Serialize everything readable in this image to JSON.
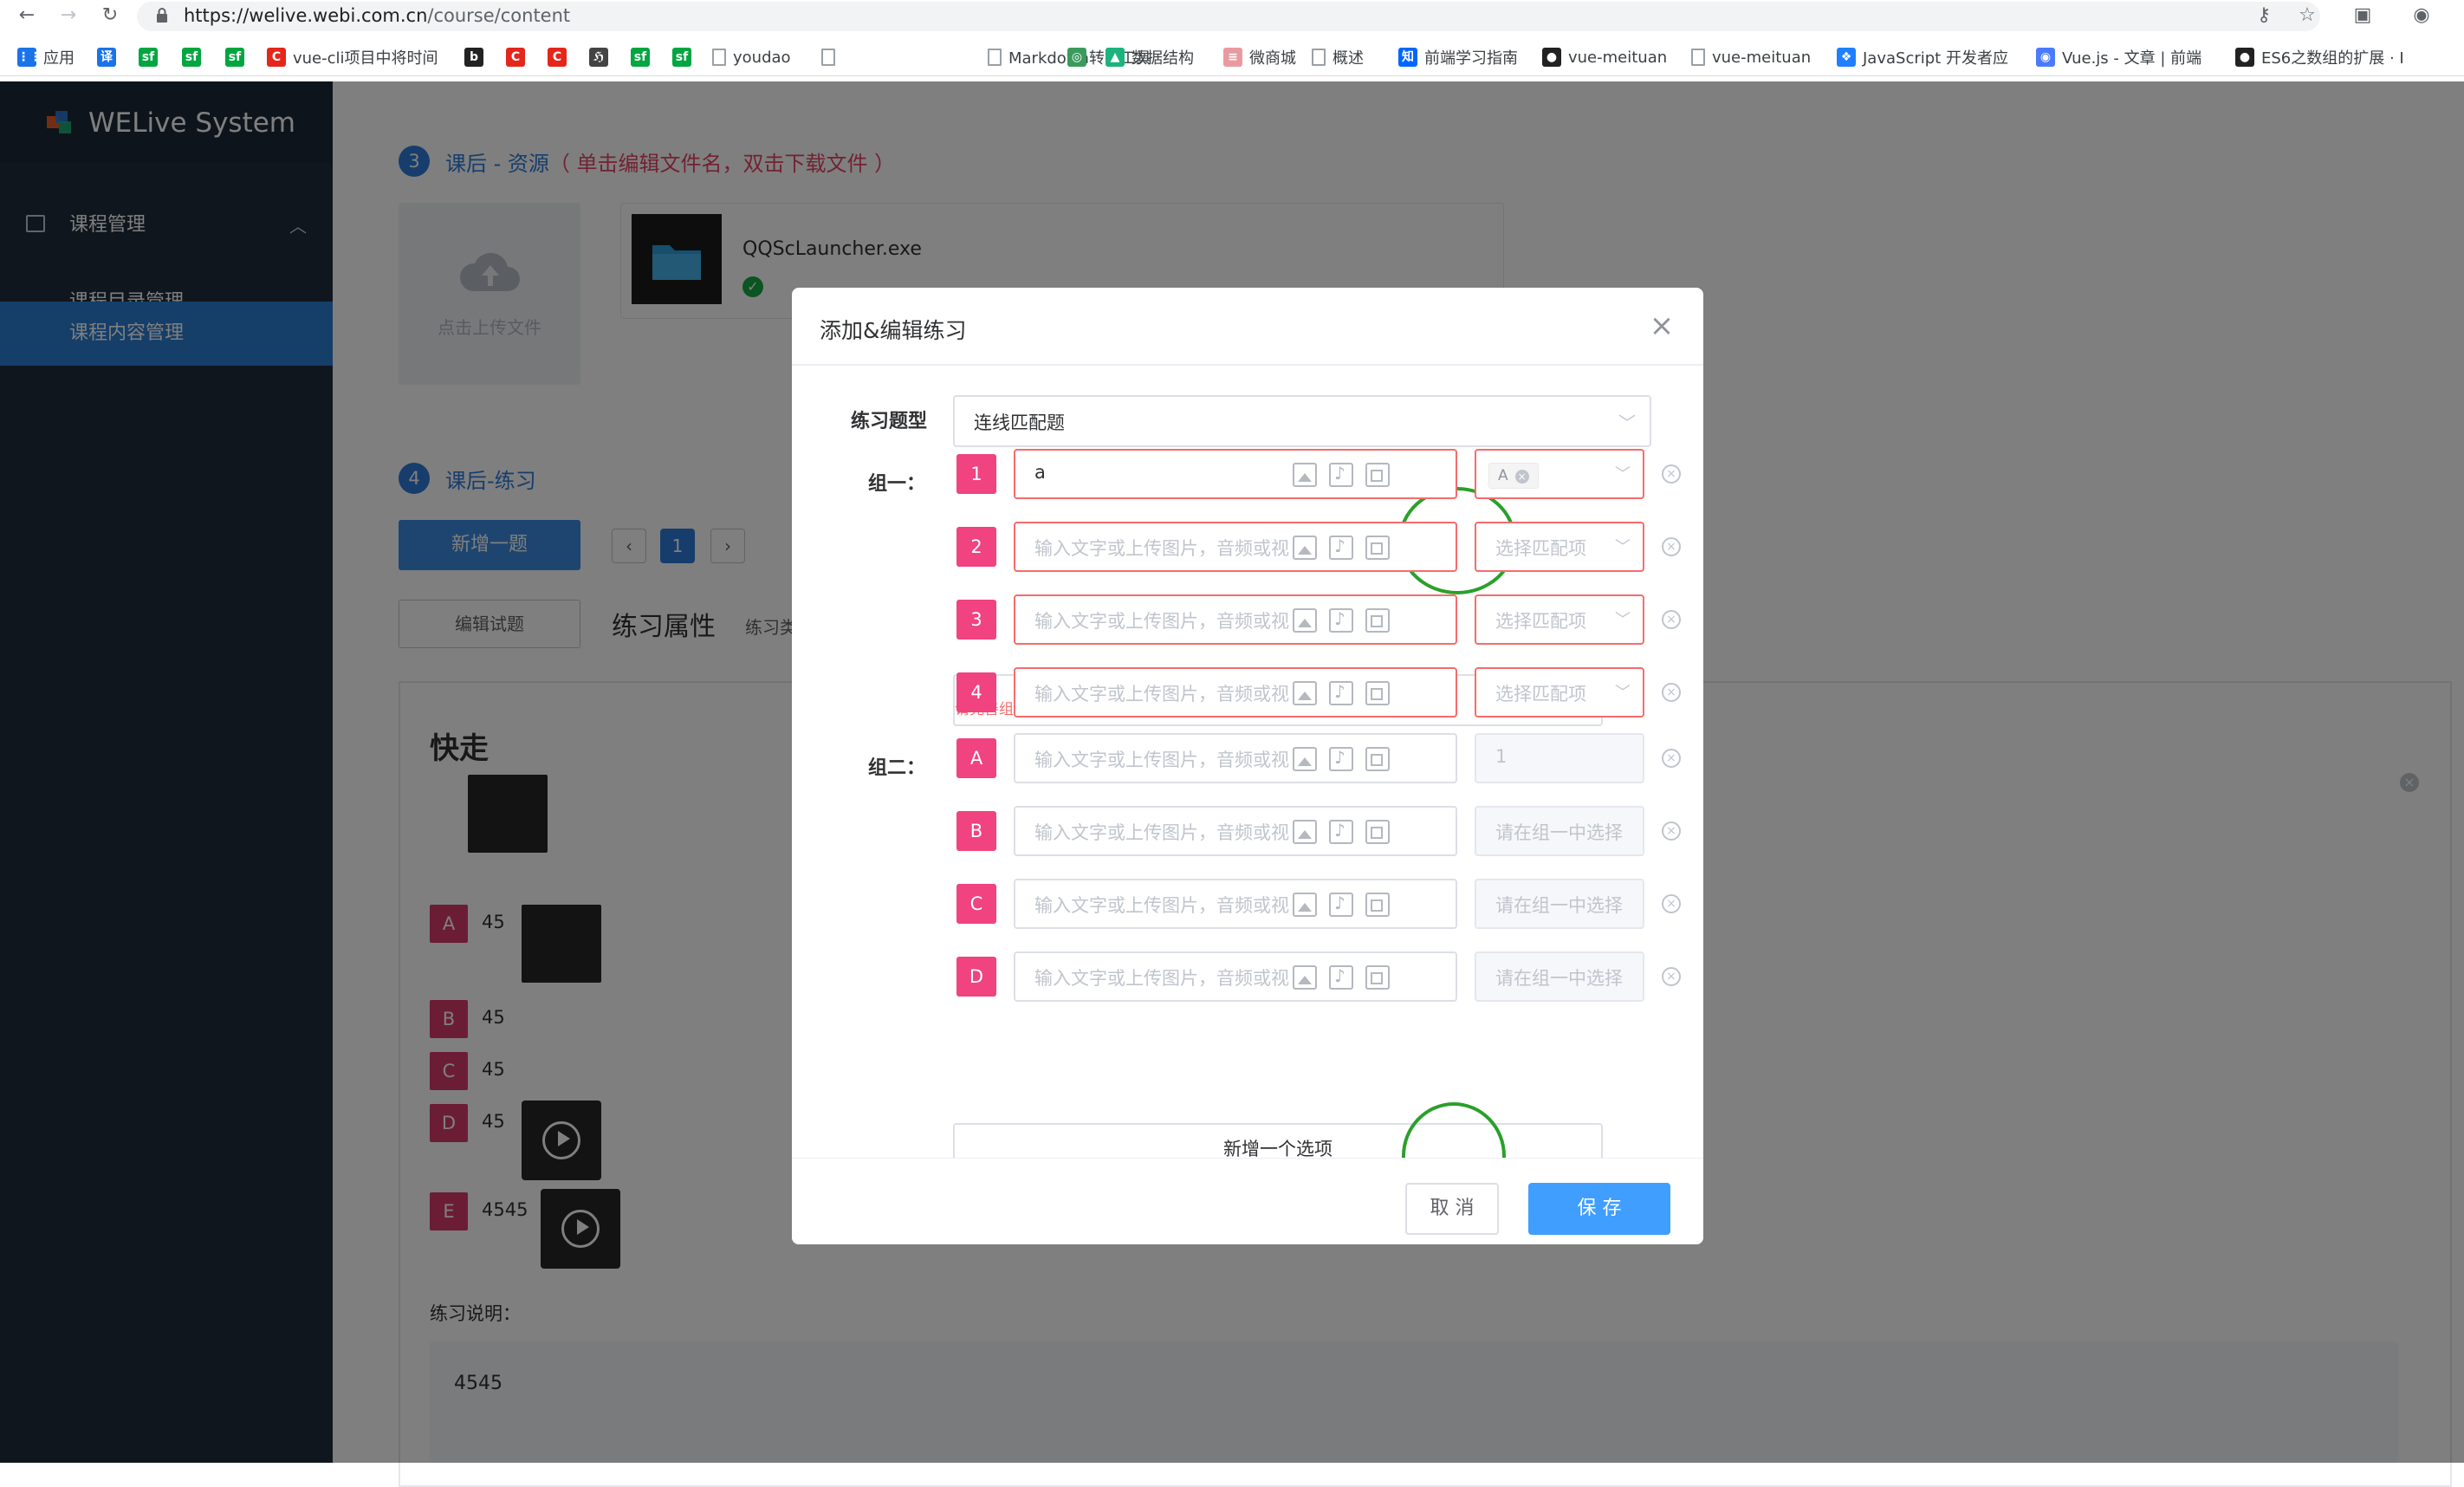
{
  "browser": {
    "url_host": "https://welive.webi.com.cn",
    "url_path": "/course/content",
    "bookmarks": [
      {
        "label": "应用",
        "icon": "apps-icon",
        "color": "#1a73e8",
        "glyph": "⋮⋮"
      },
      {
        "label": "",
        "icon": "translate-icon",
        "color": "#1a73e8",
        "glyph": "译"
      },
      {
        "label": "",
        "icon": "sf-icon",
        "color": "#00a63f",
        "glyph": "sf"
      },
      {
        "label": "",
        "icon": "sf-icon",
        "color": "#00a63f",
        "glyph": "sf"
      },
      {
        "label": "",
        "icon": "sf-icon",
        "color": "#00a63f",
        "glyph": "sf"
      },
      {
        "label": "vue-cli项目中将时间",
        "icon": "csdn-icon",
        "color": "#e4261b",
        "glyph": "C"
      },
      {
        "label": "",
        "icon": "b-icon",
        "color": "#222222",
        "glyph": "b"
      },
      {
        "label": "",
        "icon": "csdn-icon",
        "color": "#e4261b",
        "glyph": "C"
      },
      {
        "label": "",
        "icon": "csdn-icon",
        "color": "#e4261b",
        "glyph": "C"
      },
      {
        "label": "",
        "icon": "script-icon",
        "color": "#444444",
        "glyph": "ℌ"
      },
      {
        "label": "",
        "icon": "sf-icon",
        "color": "#00a63f",
        "glyph": "sf"
      },
      {
        "label": "",
        "icon": "sf-icon",
        "color": "#00a63f",
        "glyph": "sf"
      },
      {
        "label": "youdao",
        "icon": "page-icon",
        "color": "#9aa0a6",
        "glyph": ""
      },
      {
        "label": "",
        "icon": "page-icon",
        "color": "#9aa0a6",
        "glyph": ""
      },
      {
        "label": "Markdown转换工具",
        "icon": "page-icon",
        "color": "#9aa0a6",
        "glyph": ""
      },
      {
        "label": "",
        "icon": "leaf-icon",
        "color": "#3a9b5c",
        "glyph": "◎"
      },
      {
        "label": "数据结构",
        "icon": "triangle-icon",
        "color": "#1db37c",
        "glyph": "▲"
      },
      {
        "label": "微商城",
        "icon": "vue-icon",
        "color": "#e89aa0",
        "glyph": "≡"
      },
      {
        "label": "概述",
        "icon": "page-icon",
        "color": "#9aa0a6",
        "glyph": ""
      },
      {
        "label": "前端学习指南",
        "icon": "zhihu-icon",
        "color": "#0066ff",
        "glyph": "知"
      },
      {
        "label": "vue-meituan",
        "icon": "github-icon",
        "color": "#222222",
        "glyph": "●"
      },
      {
        "label": "vue-meituan",
        "icon": "page-icon",
        "color": "#9aa0a6",
        "glyph": ""
      },
      {
        "label": "JavaScript 开发者应",
        "icon": "juejin-icon",
        "color": "#1e80ff",
        "glyph": "❖"
      },
      {
        "label": "Vue.js - 文章 | 前端",
        "icon": "blue-circle-icon",
        "color": "#4a7bff",
        "glyph": "◉"
      },
      {
        "label": "ES6之数组的扩展 · I",
        "icon": "github-icon",
        "color": "#222222",
        "glyph": "●"
      }
    ]
  },
  "sidebar": {
    "logo_text": "WELive System",
    "menu_title": "课程管理",
    "items": [
      "课程目录管理",
      "课程内容管理"
    ],
    "active_index": 1
  },
  "main": {
    "section3": {
      "num": "3",
      "title": "课后 - 资源",
      "note": "（ 单击编辑文件名，双击下载文件 ）"
    },
    "upload_label": "点击上传文件",
    "file_name": "QQScLauncher.exe",
    "section4": {
      "num": "4",
      "title": "课后-练习"
    },
    "add_question": "新增一题",
    "page_current": "1",
    "edit_question": "编辑试题",
    "props_title": "练习属性",
    "props_sub": "练习类",
    "preview_title": "快走",
    "options": [
      {
        "letter": "A",
        "text": "45"
      },
      {
        "letter": "B",
        "text": "45"
      },
      {
        "letter": "C",
        "text": "45"
      },
      {
        "letter": "D",
        "text": "45"
      },
      {
        "letter": "E",
        "text": "4545"
      }
    ],
    "desc_label": "练习说明：",
    "desc_text": "4545"
  },
  "dialog": {
    "title": "添加&编辑练习",
    "type_label": "练习题型",
    "type_value": "连线匹配题",
    "group1_label": "组一：",
    "group2_label": "组二：",
    "group1_rows": [
      {
        "num": "1",
        "value": "a",
        "tag": "A"
      },
      {
        "num": "2",
        "value": "",
        "placeholder": "输入文字或上传图片，音频或视频",
        "select": "选择匹配项"
      },
      {
        "num": "3",
        "value": "",
        "placeholder": "输入文字或上传图片，音频或视频",
        "select": "选择匹配项"
      },
      {
        "num": "4",
        "value": "",
        "placeholder": "输入文字或上传图片，音频或视频",
        "select": "选择匹配项"
      }
    ],
    "group2_rows": [
      {
        "letter": "A",
        "placeholder": "输入文字或上传图片，音频或视频",
        "match": "1"
      },
      {
        "letter": "B",
        "placeholder": "输入文字或上传图片，音频或视频",
        "match": "请在组一中选择"
      },
      {
        "letter": "C",
        "placeholder": "输入文字或上传图片，音频或视频",
        "match": "请在组一中选择"
      },
      {
        "letter": "D",
        "placeholder": "输入文字或上传图片，音频或视频",
        "match": "请在组一中选择"
      }
    ],
    "add_option": "新增一个选项",
    "error": "请完善组一选项内容",
    "cancel": "取 消",
    "save": "保 存"
  },
  "colors": {
    "sidebar_bg": "#1f2d3d",
    "active_menu": "#2b7cd1",
    "badge_pink": "#f0437f",
    "primary": "#409eff",
    "error": "#f56c6c",
    "annotation_green": "#2aa02a"
  }
}
